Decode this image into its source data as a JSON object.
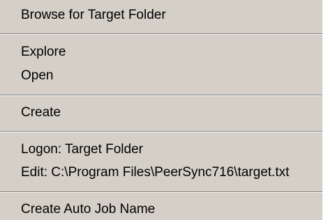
{
  "menu": {
    "browse": "Browse for Target Folder",
    "explore": "Explore",
    "open": "Open",
    "create": "Create",
    "logon": "Logon: Target Folder",
    "edit": "Edit: C:\\Program Files\\PeerSync716\\target.txt",
    "create_auto_job": "Create Auto Job Name"
  }
}
